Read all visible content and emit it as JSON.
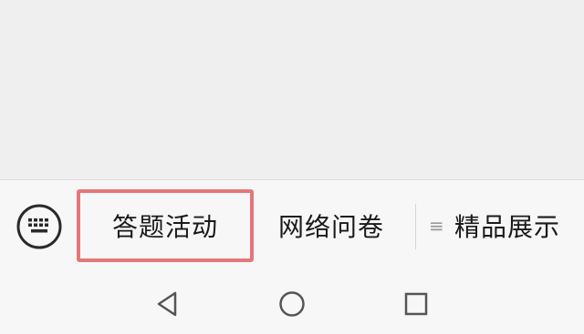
{
  "menu": {
    "items": [
      {
        "label": "答题活动",
        "highlighted": true
      },
      {
        "label": "网络问卷"
      },
      {
        "label": "精品展示",
        "icon": "list-icon"
      }
    ],
    "keyboard_icon": "keyboard-icon",
    "highlight_color": "#e5777a"
  },
  "navigation": {
    "buttons": [
      "back-triangle-icon",
      "home-circle-icon",
      "recent-square-icon"
    ]
  }
}
